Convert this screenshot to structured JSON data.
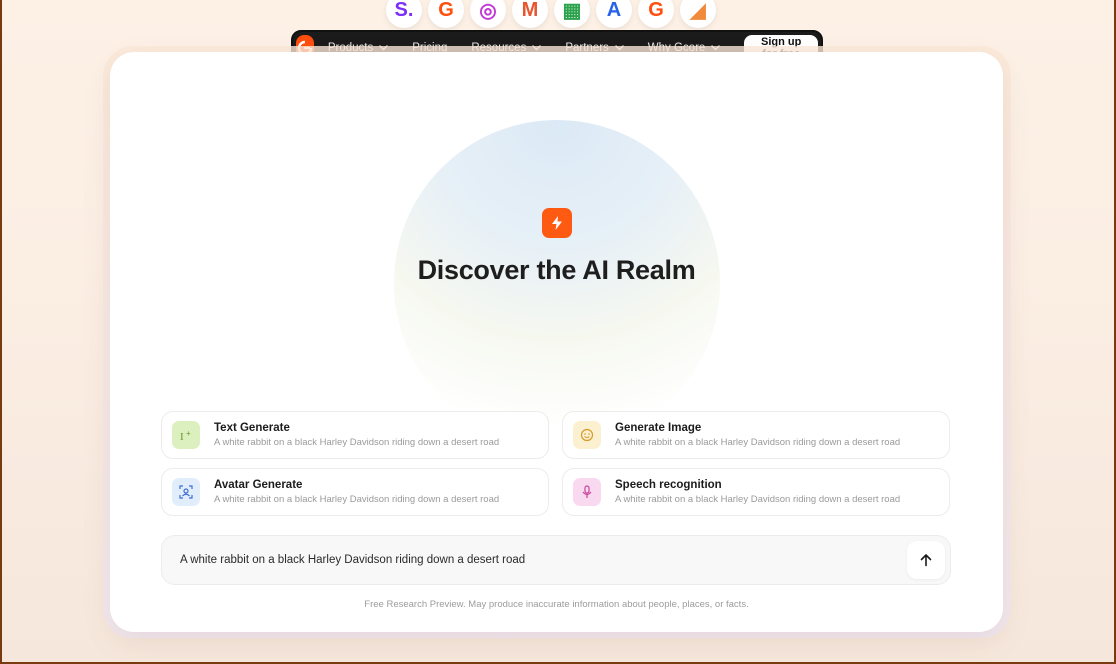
{
  "logos": [
    {
      "name": "s-brand-logo",
      "glyph": "S.",
      "color": "#7b2ff7"
    },
    {
      "name": "gcore-logo",
      "glyph": "G",
      "color": "#ff4e0d"
    },
    {
      "name": "fingerprint-logo",
      "glyph": "◎",
      "color": "#c13bd6"
    },
    {
      "name": "m-brand-logo",
      "glyph": "M",
      "color": "#e7562f"
    },
    {
      "name": "windows-logo",
      "glyph": "▦",
      "color": "#2ba24c"
    },
    {
      "name": "a-brand-logo",
      "glyph": "A",
      "color": "#2563eb"
    },
    {
      "name": "gcore-logo-2",
      "glyph": "G",
      "color": "#ff4e0d"
    },
    {
      "name": "shape-logo",
      "glyph": "◢",
      "color": "#f08a3c"
    }
  ],
  "nav": {
    "items": [
      {
        "label": "Products",
        "dropdown": true
      },
      {
        "label": "Pricing",
        "dropdown": false
      },
      {
        "label": "Resources",
        "dropdown": true
      },
      {
        "label": "Partners",
        "dropdown": true
      },
      {
        "label": "Why Gcore",
        "dropdown": true
      }
    ],
    "signup_label": "Sign up for free"
  },
  "hero": {
    "title": "Discover the AI Realm"
  },
  "options": [
    {
      "title": "Text Generate",
      "desc": "A white rabbit on a black Harley Davidson riding down a desert road",
      "icon": "text-cursor-icon",
      "icon_bg": "#dcefbf",
      "icon_color": "#6a9a2a"
    },
    {
      "title": "Generate Image",
      "desc": "A white rabbit on a black Harley Davidson riding down a desert road",
      "icon": "image-face-icon",
      "icon_bg": "#fbf0cf",
      "icon_color": "#d59a2a"
    },
    {
      "title": "Avatar Generate",
      "desc": "A white rabbit on a black Harley Davidson riding down a desert road",
      "icon": "avatar-scan-icon",
      "icon_bg": "#e2edfb",
      "icon_color": "#3e6fd0"
    },
    {
      "title": "Speech recognition",
      "desc": "A white rabbit on a black Harley Davidson riding down a desert road",
      "icon": "microphone-icon",
      "icon_bg": "#f8d9ef",
      "icon_color": "#c8469f"
    }
  ],
  "prompt": {
    "value": "A white rabbit on a black Harley Davidson riding down a desert road"
  },
  "disclaimer": "Free Research Preview. May produce inaccurate information about people, places, or facts."
}
